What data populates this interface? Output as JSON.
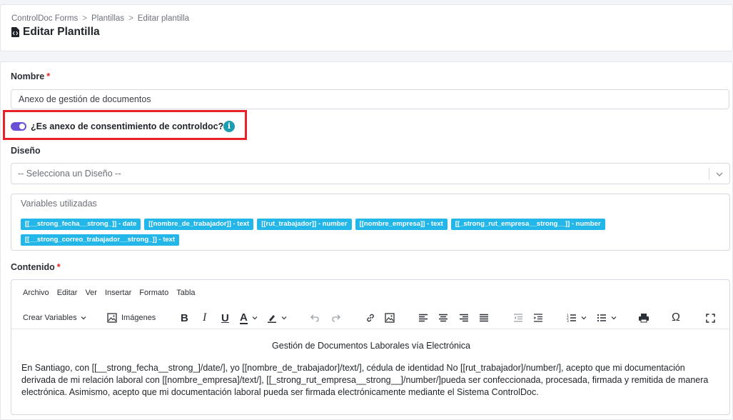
{
  "breadcrumb": {
    "root": "ControlDoc Forms",
    "section": "Plantillas",
    "current": "Editar plantilla",
    "separator": ">"
  },
  "page": {
    "title": "Editar Plantilla"
  },
  "form": {
    "nombre": {
      "label": "Nombre",
      "required": "*",
      "value": "Anexo de gestión de documentos"
    },
    "consent": {
      "label": "¿Es anexo de consentimiento de controldoc?",
      "checked": true,
      "info": "i"
    },
    "diseno": {
      "label": "Diseño",
      "placeholder": "-- Selecciona un Diseño --"
    },
    "variables": {
      "title": "Variables utilizadas",
      "items": [
        "[[__strong_fecha__strong_]] - date",
        "[[nombre_de_trabajador]] - text",
        "[[rut_trabajador]] - number",
        "[[nombre_empresa]] - text",
        "[[_strong_rut_empresa__strong__]] - number",
        "[[__strong_correo_trabajador__strong_]] - text"
      ]
    },
    "contenido": {
      "label": "Contenido",
      "required": "*"
    }
  },
  "editor": {
    "menu": [
      "Archivo",
      "Editar",
      "Ver",
      "Insertar",
      "Formato",
      "Tabla"
    ],
    "toolbar": {
      "crear_variables": "Crear Variables",
      "imagenes": "Imágenes",
      "bold": "B",
      "italic": "I",
      "underline": "U",
      "font_color": "A",
      "special_char": "Ω"
    },
    "content": {
      "title": "Gestión de Documentos Laborales vía Electrónica",
      "paragraph": "En Santiago, con [[__strong_fecha__strong_]/date/], yo [[nombre_de_trabajador]/text/], cédula de identidad No [[rut_trabajador]/number/], acepto que mi documentación derivada de mi relación laboral con [[nombre_empresa]/text/], [[_strong_rut_empresa__strong__]/number/]pueda ser confeccionada, procesada, firmada y remitida de manera electrónica. Asimismo, acepto que mi documentación laboral pueda ser firmada electrónicamente mediante el Sistema ControlDoc."
    }
  },
  "colors": {
    "toggle": "#6a4fd6",
    "chip": "#22b7e8",
    "highlight": "#e8202a",
    "info": "#1b9cb0",
    "required": "#e02424"
  }
}
